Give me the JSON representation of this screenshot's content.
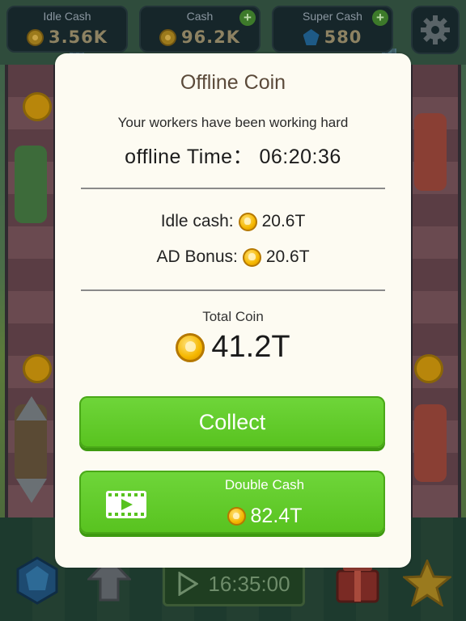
{
  "hud": {
    "idle_cash": {
      "label": "Idle Cash",
      "value": "3.56K",
      "icon": "coin-icon"
    },
    "cash": {
      "label": "Cash",
      "value": "96.2K",
      "icon": "coin-icon",
      "add": "+"
    },
    "super_cash": {
      "label": "Super Cash",
      "value": "580",
      "icon": "gem-icon",
      "add": "+"
    },
    "settings_icon": "gear-icon"
  },
  "dialog": {
    "title": "Offline Coin",
    "subtitle": "Your workers have been working hard",
    "offline_time": "offline Time： 06:20:36",
    "idle_cash_label": "Idle cash:",
    "idle_cash_value": "20.6T",
    "ad_bonus_label": "AD Bonus:",
    "ad_bonus_value": "20.6T",
    "total_label": "Total Coin",
    "total_value": "41.2T",
    "collect_label": "Collect",
    "double_label": "Double Cash",
    "double_value": "82.4T",
    "double_icon": "video-icon"
  },
  "bottom_bar": {
    "timer": "16:35:00",
    "icons": [
      "gem-shop-icon",
      "upgrade-arrow-icon",
      "play-icon",
      "gift-box-icon",
      "star-icon"
    ]
  },
  "colors": {
    "button_green": "#58c21f",
    "dialog_bg": "#fdfbf2",
    "coin_gold": "#f5b700"
  }
}
